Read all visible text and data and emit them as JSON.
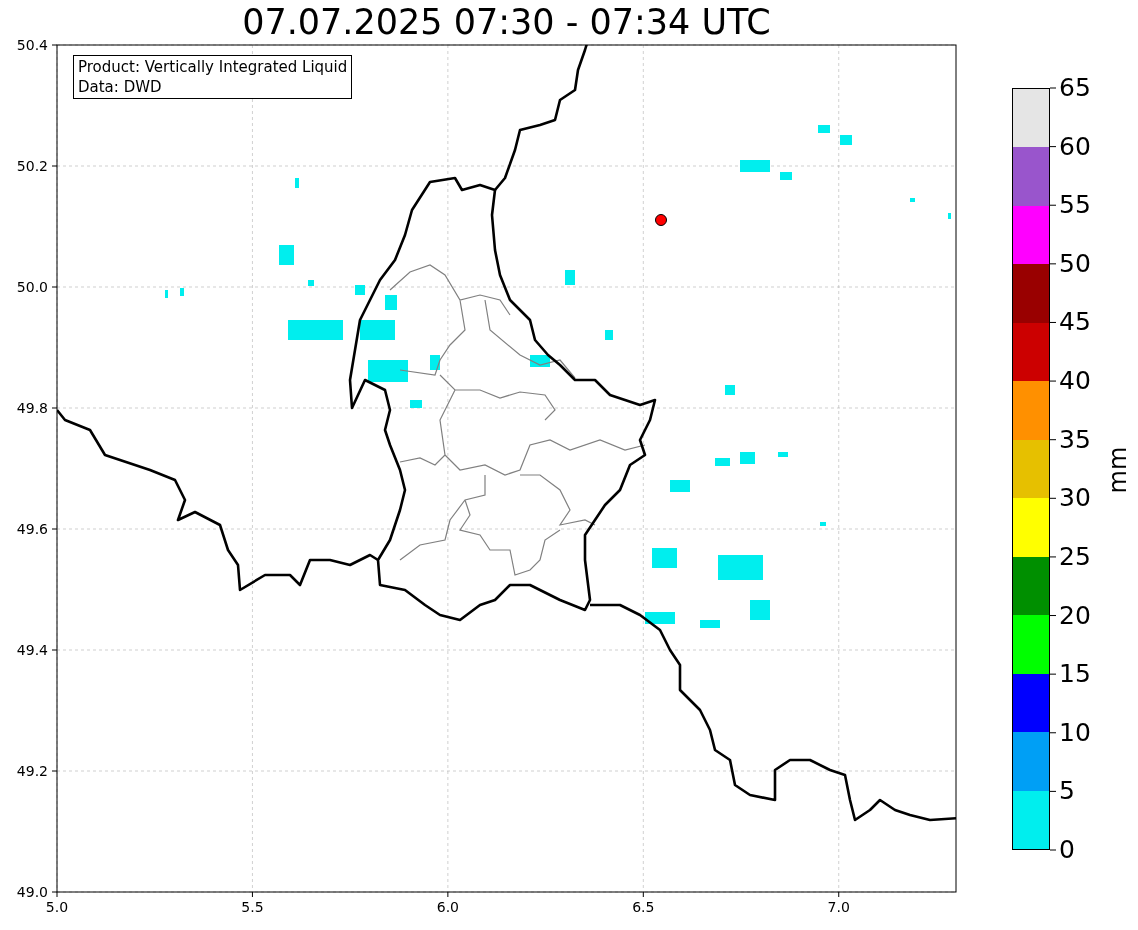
{
  "title": "07.07.2025 07:30 - 07:34 UTC",
  "map": {
    "legend_box": [
      "Product: Vertically Integrated Liquid",
      "Data: DWD"
    ],
    "x_ticks": [
      "5.0",
      "5.5",
      "6.0",
      "6.5",
      "7.0"
    ],
    "y_ticks": [
      "50.4",
      "50.2",
      "50.0",
      "49.8",
      "49.6",
      "49.4",
      "49.2",
      "49.0"
    ]
  },
  "colorbar": {
    "label": "mm",
    "ticks": [
      "65",
      "60",
      "55",
      "50",
      "45",
      "40",
      "35",
      "30",
      "25",
      "20",
      "15",
      "10",
      "5",
      "0"
    ],
    "bins": [
      {
        "color": "#e5e5e5"
      },
      {
        "color": "#9955cc"
      },
      {
        "color": "#ff00ff"
      },
      {
        "color": "#990000"
      },
      {
        "color": "#cc0000"
      },
      {
        "color": "#ff9000"
      },
      {
        "color": "#e6c000"
      },
      {
        "color": "#ffff00"
      },
      {
        "color": "#008f00"
      },
      {
        "color": "#00ff00"
      },
      {
        "color": "#0000ff"
      },
      {
        "color": "#009ff5"
      },
      {
        "color": "#00eeee"
      }
    ]
  }
}
